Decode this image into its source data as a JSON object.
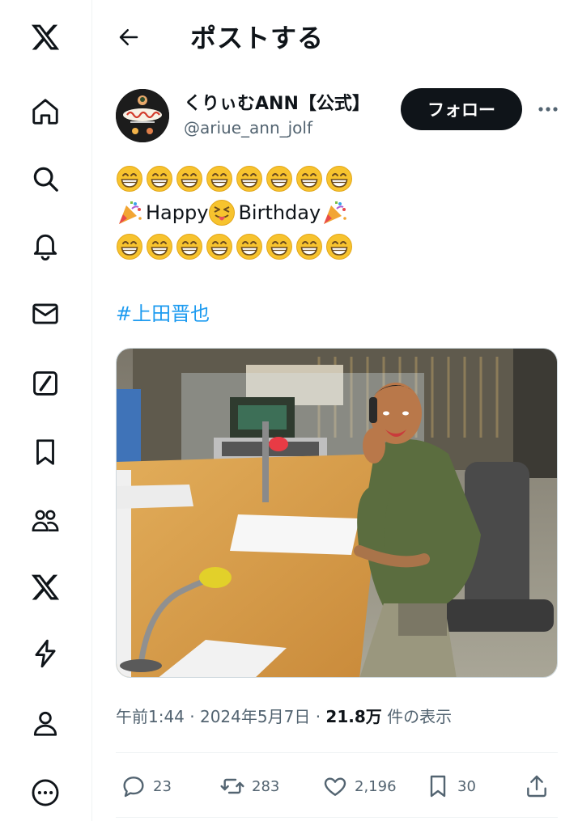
{
  "sidebar": {
    "items": [
      {
        "icon": "x-logo-icon"
      },
      {
        "icon": "home-icon"
      },
      {
        "icon": "search-icon"
      },
      {
        "icon": "bell-icon"
      },
      {
        "icon": "mail-icon"
      },
      {
        "icon": "grok-icon"
      },
      {
        "icon": "bookmark-icon"
      },
      {
        "icon": "communities-icon"
      },
      {
        "icon": "premium-x-icon"
      },
      {
        "icon": "verified-orgs-icon"
      },
      {
        "icon": "profile-icon"
      },
      {
        "icon": "more-circle-icon"
      }
    ]
  },
  "header": {
    "title": "ポストする"
  },
  "post": {
    "display_name": "くりぃむANN【公式】",
    "handle": "@ariue_ann_jolf",
    "follow_label": "フォロー",
    "line2_happy": "Happy ",
    "line2_birthday": "Birthday",
    "hashtag": "#上田晋也",
    "timestamp": "午前1:44 · 2024年5月7日 · ",
    "views_count": "21.8万",
    "views_label": " 件の表示",
    "replies": "23",
    "reposts": "283",
    "likes": "2,196",
    "bookmarks": "30"
  },
  "colors": {
    "accent": "#1d9bf0",
    "text_primary": "#0f1419",
    "text_secondary": "#536471",
    "follow_bg": "#0f1419"
  }
}
